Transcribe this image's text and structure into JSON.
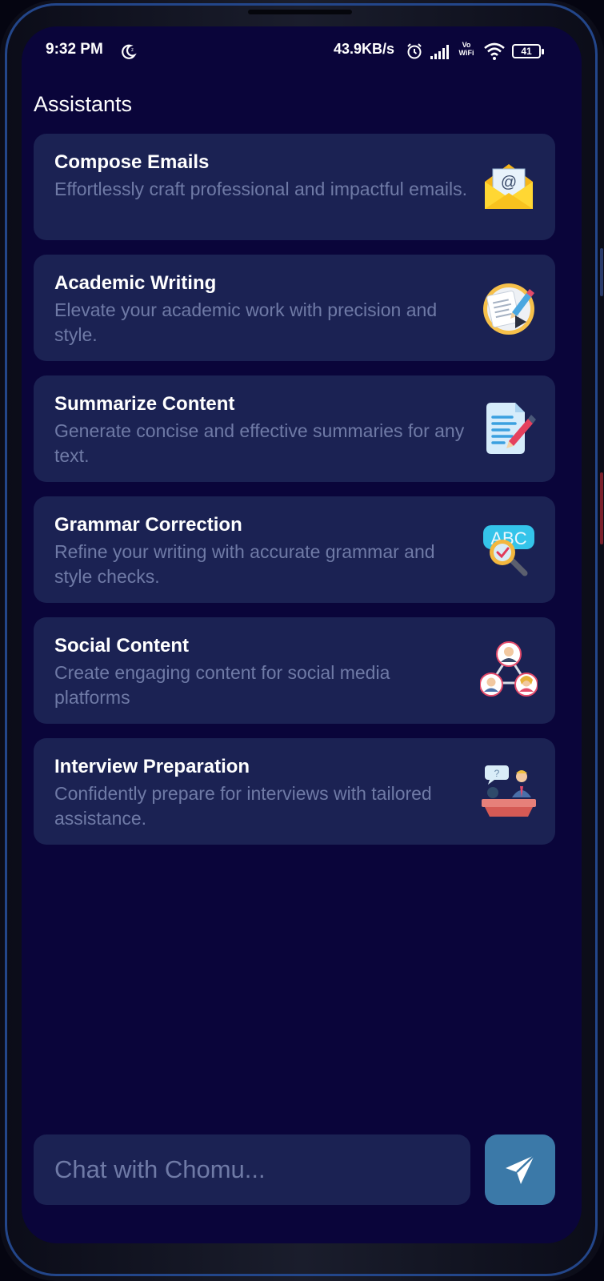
{
  "status_bar": {
    "time": "9:32 PM",
    "net_speed": "43.9KB/s",
    "vowifi_top": "Vo",
    "vowifi_bottom": "WiFi",
    "battery": "41"
  },
  "section_title": "Assistants",
  "assistants": [
    {
      "title": "Compose Emails",
      "description": "Effortlessly craft professional and impactful emails.",
      "icon": "email-envelope-icon"
    },
    {
      "title": "Academic Writing",
      "description": "Elevate your academic work with precision and style.",
      "icon": "academic-writing-icon"
    },
    {
      "title": "Summarize Content",
      "description": "Generate concise and effective summaries for any text.",
      "icon": "document-pen-icon"
    },
    {
      "title": "Grammar Correction",
      "description": "Refine your writing with accurate grammar and style checks.",
      "icon": "abc-magnifier-icon"
    },
    {
      "title": "Social Content",
      "description": "Create engaging content for social media platforms",
      "icon": "social-network-icon"
    },
    {
      "title": "Interview Preparation",
      "description": "Confidently prepare for interviews with tailored assistance.",
      "icon": "interview-icon",
      "icon_label": "?"
    }
  ],
  "chat": {
    "placeholder": "Chat with Chomu..."
  },
  "colors": {
    "background": "#0a053a",
    "card": "#1b2253",
    "description_text": "#6f7aa6",
    "send_button": "#3b79a8"
  }
}
